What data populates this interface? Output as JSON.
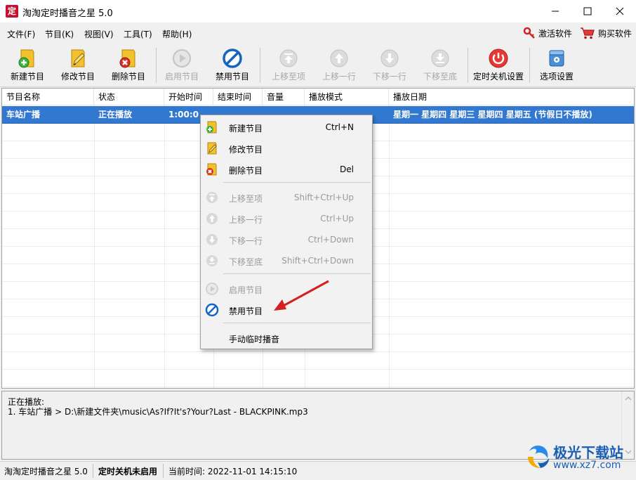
{
  "app": {
    "icon_char": "定",
    "title": "淘淘定时播音之星 5.0"
  },
  "menu": {
    "items": [
      "文件(F)",
      "节目(K)",
      "视图(V)",
      "工具(T)",
      "帮助(H)"
    ],
    "activate": "激活软件",
    "buy": "购买软件"
  },
  "toolbar": {
    "buttons": [
      {
        "label": "新建节目",
        "icon": "add-program-icon",
        "enabled": true
      },
      {
        "label": "修改节目",
        "icon": "edit-program-icon",
        "enabled": true
      },
      {
        "label": "删除节目",
        "icon": "delete-program-icon",
        "enabled": true
      },
      {
        "label": "启用节目",
        "icon": "play-icon",
        "enabled": false
      },
      {
        "label": "禁用节目",
        "icon": "disable-icon",
        "enabled": true
      },
      {
        "label": "上移至项",
        "icon": "move-top-icon",
        "enabled": false
      },
      {
        "label": "上移一行",
        "icon": "move-up-icon",
        "enabled": false
      },
      {
        "label": "下移一行",
        "icon": "move-down-icon",
        "enabled": false
      },
      {
        "label": "下移至底",
        "icon": "move-bottom-icon",
        "enabled": false
      },
      {
        "label": "定时关机设置",
        "icon": "power-icon",
        "enabled": true
      },
      {
        "label": "选项设置",
        "icon": "settings-icon",
        "enabled": true
      }
    ]
  },
  "table": {
    "columns": [
      "节目名称",
      "状态",
      "开始时间",
      "结束时间",
      "音量",
      "播放模式",
      "播放日期"
    ],
    "rows": [
      [
        "车站广播",
        "正在播放",
        "1:00:0",
        "",
        "",
        "",
        "星期一 星期四 星期三 星期四 星期五 (节假日不播放)"
      ]
    ]
  },
  "context_menu": {
    "items": [
      {
        "label": "新建节目",
        "shortcut": "Ctrl+N",
        "icon": "add-program-icon",
        "enabled": true
      },
      {
        "label": "修改节目",
        "shortcut": "",
        "icon": "edit-program-icon",
        "enabled": true
      },
      {
        "label": "删除节目",
        "shortcut": "Del",
        "icon": "delete-program-icon",
        "enabled": true
      },
      {
        "label": "上移至项",
        "shortcut": "Shift+Ctrl+Up",
        "icon": "move-top-icon",
        "enabled": false
      },
      {
        "label": "上移一行",
        "shortcut": "Ctrl+Up",
        "icon": "move-up-icon",
        "enabled": false
      },
      {
        "label": "下移一行",
        "shortcut": "Ctrl+Down",
        "icon": "move-down-icon",
        "enabled": false
      },
      {
        "label": "下移至底",
        "shortcut": "Shift+Ctrl+Down",
        "icon": "move-bottom-icon",
        "enabled": false
      },
      {
        "label": "启用节目",
        "shortcut": "",
        "icon": "play-icon",
        "enabled": false
      },
      {
        "label": "禁用节目",
        "shortcut": "",
        "icon": "disable-icon",
        "enabled": true
      },
      {
        "label": "手动临时播音",
        "shortcut": "",
        "icon": "",
        "enabled": true
      }
    ]
  },
  "now_playing": {
    "title": "正在播放:",
    "line": "1. 车站广播 > D:\\新建文件夹\\music\\As?If?It's?Your?Last - BLACKPINK.mp3"
  },
  "statusbar": {
    "app": "淘淘定时播音之星 5.0",
    "shutdown": "定时关机未启用",
    "time": "当前时间:  2022-11-01 14:15:10"
  },
  "watermark": {
    "text": "极光下载站",
    "url": "www.xz7.com"
  },
  "colors": {
    "selection": "#3278d0",
    "annotation_arrow": "#d42020"
  }
}
